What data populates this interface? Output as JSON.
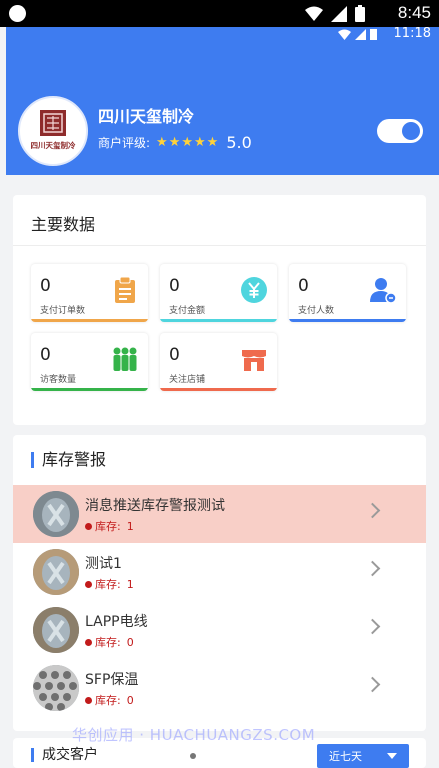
{
  "status_bar": {
    "time": "8:45"
  },
  "inner_status_bar": {
    "time": "11:18"
  },
  "shop": {
    "name": "四川天玺制冷",
    "avatar_text": "四川天玺制冷",
    "rating_label": "商户评级:",
    "rating_value": "5.0",
    "stars": 5,
    "toggle_on": true
  },
  "main_data": {
    "title": "主要数据",
    "stats": [
      {
        "value": "0",
        "label": "支付订单数",
        "icon": "clipboard-icon",
        "color": "#f0a64a"
      },
      {
        "value": "0",
        "label": "支付金额",
        "icon": "yen-coin-icon",
        "color": "#4fd5de"
      },
      {
        "value": "0",
        "label": "支付人数",
        "icon": "user-icon",
        "color": "#3e7cf0"
      },
      {
        "value": "0",
        "label": "访客数量",
        "icon": "visitors-icon",
        "color": "#35b34a"
      },
      {
        "value": "0",
        "label": "关注店铺",
        "icon": "store-icon",
        "color": "#ef6a4d"
      }
    ]
  },
  "inventory": {
    "title": "库存警报",
    "items": [
      {
        "name": "消息推送库存警报测试",
        "stock_label": "库存:",
        "stock": "1",
        "highlighted": true
      },
      {
        "name": "测试1",
        "stock_label": "库存:",
        "stock": "1",
        "highlighted": false
      },
      {
        "name": "LAPP电线",
        "stock_label": "库存:",
        "stock": "0",
        "highlighted": false
      },
      {
        "name": "SFP保温",
        "stock_label": "库存:",
        "stock": "0",
        "highlighted": false
      }
    ]
  },
  "customers": {
    "title": "成交客户",
    "dropdown_value": "近七天"
  },
  "watermark": "华创应用 · HUACHUANGZS.COM",
  "colors": {
    "accent": "#3e7cf0",
    "highlight_row": "#f8cfc7",
    "stock_dot": "#c21b1b"
  }
}
